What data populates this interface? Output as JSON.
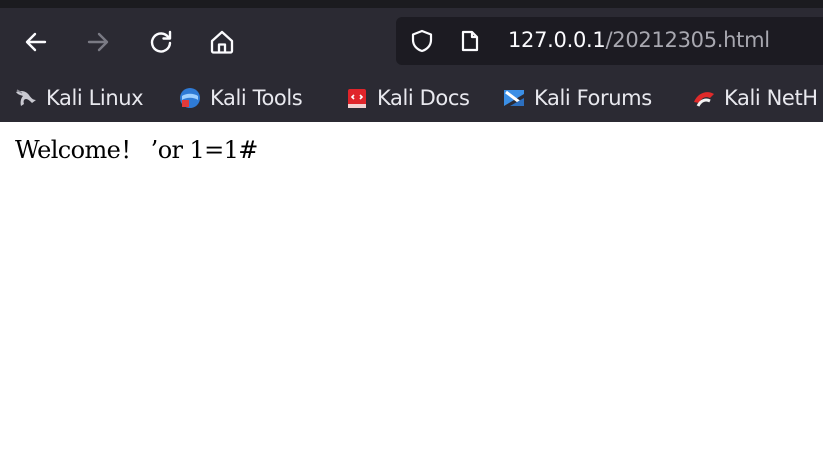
{
  "toolbar": {
    "back_icon": "back-arrow-icon",
    "forward_icon": "forward-arrow-icon",
    "reload_icon": "reload-icon",
    "home_icon": "home-icon"
  },
  "urlbar": {
    "host": "127.0.0.1",
    "path": "/20212305.html",
    "shield_icon": "shield-icon",
    "page_icon": "page-icon"
  },
  "bookmarks": {
    "items": [
      {
        "label": "Kali Linux",
        "icon": "kali-dragon-icon"
      },
      {
        "label": "Kali Tools",
        "icon": "kali-tools-icon"
      },
      {
        "label": "Kali Docs",
        "icon": "kali-docs-icon"
      },
      {
        "label": "Kali Forums",
        "icon": "kali-forums-icon"
      },
      {
        "label": "Kali NetH",
        "icon": "kali-nethunter-icon"
      }
    ]
  },
  "page": {
    "text": "Welcome！ ’or 1=1#"
  },
  "colors": {
    "chrome_bg": "#2b2a33",
    "urlbar_bg": "#1c1b22",
    "page_bg": "#ffffff"
  }
}
